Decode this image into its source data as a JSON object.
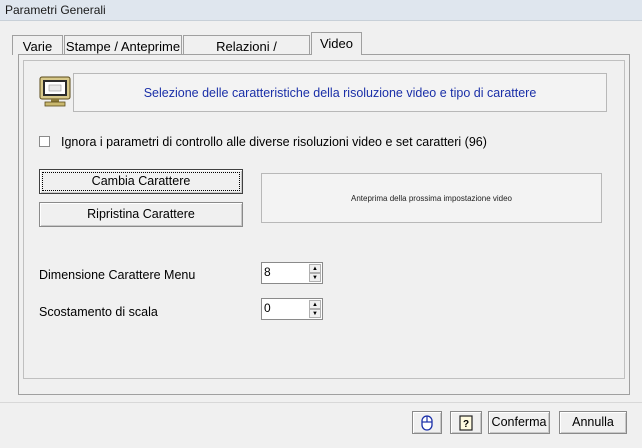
{
  "window": {
    "title": "Parametri Generali"
  },
  "tabs": [
    {
      "label": "Varie"
    },
    {
      "label": "Stampe / Anteprime"
    },
    {
      "label": "Relazioni / Documenti"
    },
    {
      "label": "Video",
      "active": true
    }
  ],
  "video": {
    "header_text": "Selezione delle caratteristiche della risoluzione video e tipo di carattere",
    "ignore_checkbox": {
      "label": "Ignora i parametri di controllo alle diverse risoluzioni video e set caratteri (96)",
      "checked": false
    },
    "change_font_label": "Cambia Carattere",
    "restore_font_label": "Ripristina Carattere",
    "preview_text": "Anteprima della prossima impostazione video",
    "menu_font_size": {
      "label": "Dimensione Carattere Menu",
      "value": "8"
    },
    "scale_offset": {
      "label": "Scostamento di scala",
      "value": "0"
    }
  },
  "footer": {
    "confirm_label": "Conferma",
    "cancel_label": "Annulla",
    "icon_button_1": "mouse-icon",
    "icon_button_2": "help-icon"
  },
  "colors": {
    "header_text": "#1a2fa8",
    "title_bar": "#dfe6ee"
  }
}
